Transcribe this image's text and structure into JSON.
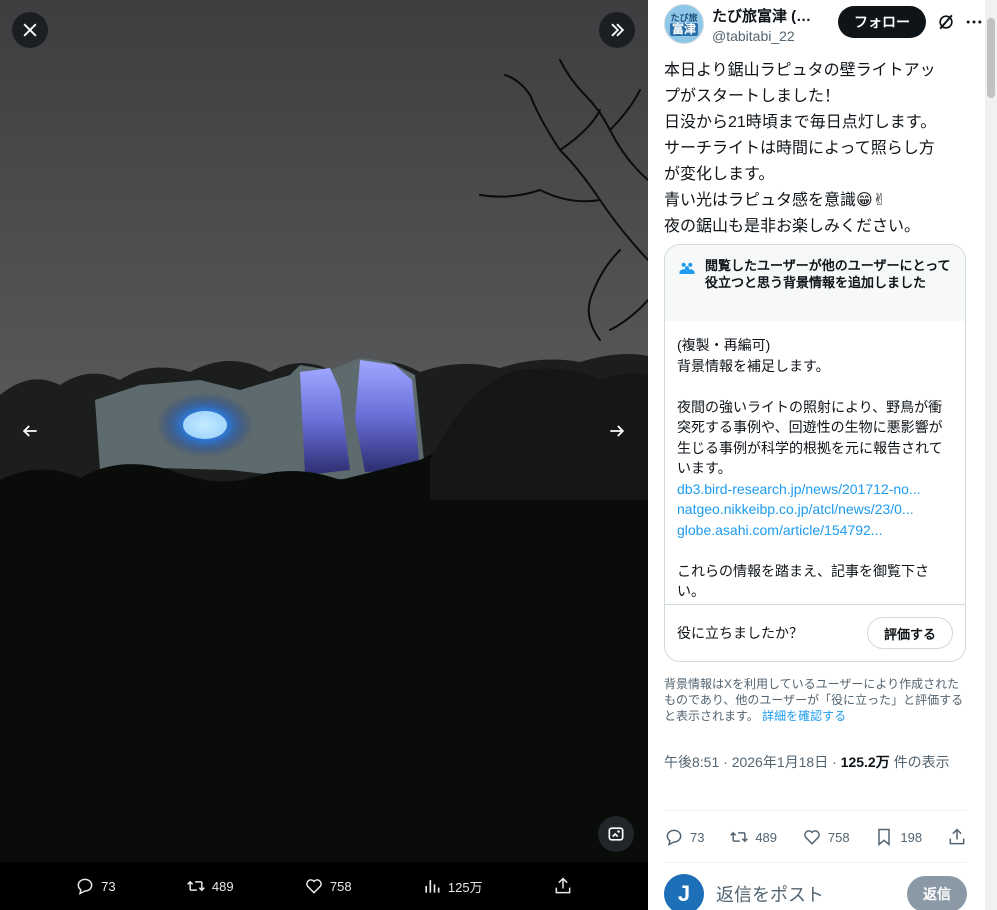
{
  "viewer": {
    "actions": {
      "replies": "73",
      "reposts": "489",
      "likes": "758",
      "views": "125万"
    }
  },
  "author": {
    "display_name": "たび旅富津 (…",
    "handle": "@tabitabi_22",
    "avatar_top": "たび旅",
    "avatar_bottom": "富津",
    "follow_label": "フォロー"
  },
  "tweet": {
    "lines": [
      "本日より鋸山ラピュタの壁ライトアッ",
      "プがスタートしました！",
      "日没から21時頃まで毎日点灯します。",
      "サーチライトは時間によって照らし方",
      "が変化します。",
      "青い光はラピュタ感を意識😁✌",
      "夜の鋸山も是非お楽しみください。"
    ]
  },
  "note": {
    "title": "閲覧したユーザーが他のユーザーにとって役立つと思う背景情報を追加しました",
    "body": {
      "line1": "(複製・再編可)",
      "line2": "背景情報を補足します。",
      "para": "夜間の強いライトの照射により、野鳥が衝突死する事例や、回遊性の生物に悪影響が生じる事例が科学的根拠を元に報告されています。",
      "links": [
        "db3.bird-research.jp/news/201712-no...",
        "natgeo.nikkeibp.co.jp/atcl/news/23/0...",
        "globe.asahi.com/article/154792..."
      ],
      "closing": "これらの情報を踏まえ、記事を御覧下さい。"
    },
    "question": "役に立ちましたか？",
    "rate_label": "評価する"
  },
  "disclaimer": {
    "text": "背景情報はXを利用しているユーザーにより作成されたものであり、他のユーザーが「役に立った」と評価すると表示されます。",
    "link": "詳細を確認する"
  },
  "meta": {
    "time": "午後8:51",
    "date": "2026年1月18日",
    "views_count": "125.2万",
    "views_suffix": "件の表示"
  },
  "panel_actions": {
    "replies": "73",
    "reposts": "489",
    "likes": "758",
    "bookmarks": "198"
  },
  "reply": {
    "avatar_letter": "J",
    "placeholder": "返信をポスト",
    "button": "返信"
  },
  "colors": {
    "accent": "#1d9bf0",
    "follow_bg": "#0f1419",
    "viewer_bg": "#000000"
  }
}
